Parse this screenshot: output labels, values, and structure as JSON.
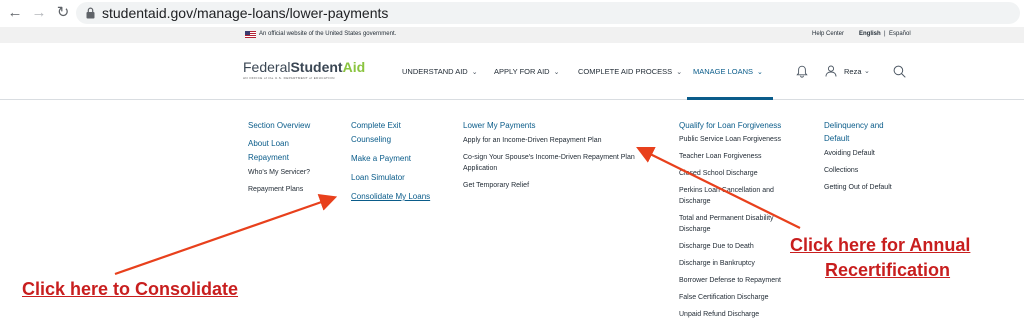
{
  "browser": {
    "url": "studentaid.gov/manage-loans/lower-payments"
  },
  "gov_banner": {
    "official_text": "An official website of the United States government.",
    "help_center": "Help Center",
    "lang_english": "English",
    "lang_sep": "|",
    "lang_espanol": "Español"
  },
  "header": {
    "logo_federal": "Federal",
    "logo_student": "Student",
    "logo_aid": "Aid",
    "logo_sub": "AN OFFICE of the U.S. DEPARTMENT of EDUCATION",
    "nav": [
      {
        "label": "UNDERSTAND AID"
      },
      {
        "label": "APPLY FOR AID"
      },
      {
        "label": "COMPLETE AID PROCESS"
      },
      {
        "label": "MANAGE LOANS"
      }
    ],
    "user_name": "Reza"
  },
  "menu": {
    "col1": {
      "section_overview": "Section Overview",
      "about_line1": "About Loan",
      "about_line2": "Repayment",
      "whos_servicer": "Who's My Servicer?",
      "repayment_plans": "Repayment Plans"
    },
    "col2": {
      "exit_line1": "Complete Exit",
      "exit_line2": "Counseling",
      "make_payment": "Make a Payment",
      "loan_simulator": "Loan Simulator",
      "consolidate": "Consolidate My Loans"
    },
    "col3": {
      "heading": "Lower My Payments",
      "apply_idr": "Apply for an Income-Driven Repayment Plan",
      "cosign_line1": "Co-sign Your Spouse's Income-Driven Repayment Plan",
      "cosign_line2": "Application",
      "temp_relief": "Get Temporary Relief"
    },
    "col4": {
      "heading": "Qualify for Loan Forgiveness",
      "items": [
        "Public Service Loan Forgiveness",
        "Teacher Loan Forgiveness",
        "Closed School Discharge",
        "Perkins Loan Cancellation and",
        "Discharge",
        "Total and Permanent Disability",
        "Discharge",
        "Discharge Due to Death",
        "Discharge in Bankruptcy",
        "Borrower Defense to Repayment",
        "False Certification Discharge",
        "Unpaid Refund Discharge"
      ]
    },
    "col5": {
      "heading_line1": "Delinquency and",
      "heading_line2": "Default",
      "items": [
        "Avoiding Default",
        "Collections",
        "Getting Out of Default"
      ]
    }
  },
  "annotations": {
    "consolidate": "Click here to Consolidate",
    "recert_line1": "Click here for Annual",
    "recert_line2": "Recertification",
    "color": "#c81e1e"
  }
}
